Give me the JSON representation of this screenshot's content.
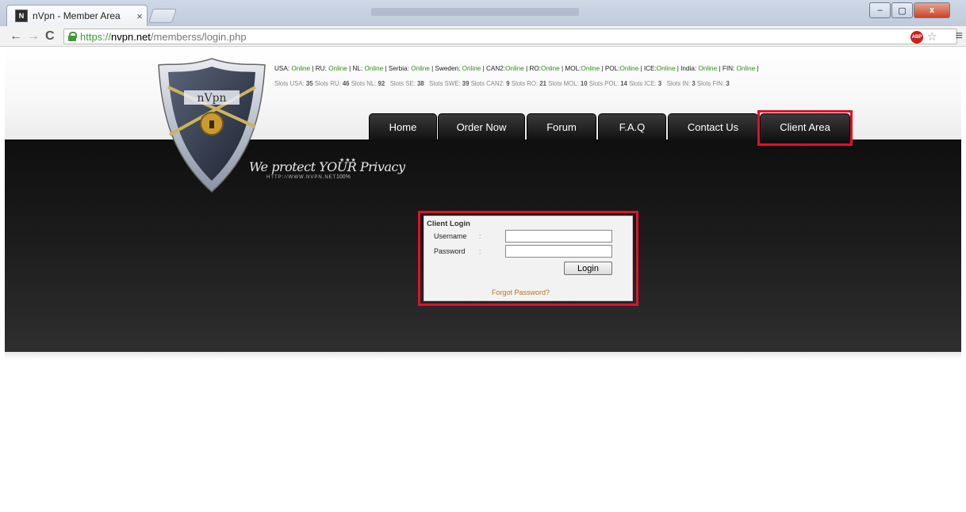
{
  "browser": {
    "tab_title": "nVpn - Member Area",
    "tab_close": "×",
    "favicon_text": "N",
    "url_scheme": "https://",
    "url_host": "nvpn.net",
    "url_path": "/memberss/login.php",
    "win_min": "–",
    "win_max": "▢",
    "win_close": "x",
    "nav_back": "←",
    "nav_forward": "→",
    "nav_reload": "C",
    "abp_label": "ABP",
    "bookmark_star": "☆",
    "menu_glyph": "≡"
  },
  "site": {
    "logo_text": "nVpn",
    "tagline": "We protect YOUR Privacy",
    "tagline_url": "HTTP://WWW.NVPN.NET",
    "tagline_percent": "100%",
    "tagline_stars": "★★★",
    "status": [
      {
        "label": "USA:",
        "value": "Online"
      },
      {
        "label": "RU:",
        "value": "Online"
      },
      {
        "label": "NL:",
        "value": "Online"
      },
      {
        "label": "Serbia:",
        "value": "Online"
      },
      {
        "label": "Sweden:",
        "value": "Online"
      },
      {
        "label": "CAN2:",
        "value": "Online"
      },
      {
        "label": "RO:",
        "value": "Online"
      },
      {
        "label": "MOL:",
        "value": "Online"
      },
      {
        "label": "POL:",
        "value": "Online"
      },
      {
        "label": "ICE:",
        "value": "Online"
      },
      {
        "label": "India:",
        "value": "Online"
      },
      {
        "label": "FIN:",
        "value": "Online"
      }
    ],
    "slots": [
      {
        "label": "Slots USA:",
        "value": "35"
      },
      {
        "label": "Slots RU:",
        "value": "46"
      },
      {
        "label": "Slots NL:",
        "value": "92"
      },
      {
        "label": "Slots SE:",
        "value": "38"
      },
      {
        "label": "Slots SWE:",
        "value": "39"
      },
      {
        "label": "Slots CAN2:",
        "value": "9"
      },
      {
        "label": "Slots RO:",
        "value": "21"
      },
      {
        "label": "Slots MOL:",
        "value": "10"
      },
      {
        "label": "Slots POL:",
        "value": "14"
      },
      {
        "label": "Slots ICE:",
        "value": "3"
      },
      {
        "label": "Slots IN:",
        "value": "3"
      },
      {
        "label": "Slots FIN:",
        "value": "3"
      }
    ],
    "nav": {
      "home": "Home",
      "order": "Order Now",
      "forum": "Forum",
      "faq": "F.A.Q",
      "contact": "Contact Us",
      "client_area": "Client Area"
    }
  },
  "login": {
    "title": "Client Login",
    "username_label": "Username",
    "password_label": "Password",
    "colon": ":",
    "username_value": "",
    "password_value": "",
    "button": "Login",
    "forgot": "Forgot Password?"
  },
  "colors": {
    "online": "#2e8b1a",
    "highlight": "#e0102a",
    "forgot_link": "#b57a1a"
  }
}
